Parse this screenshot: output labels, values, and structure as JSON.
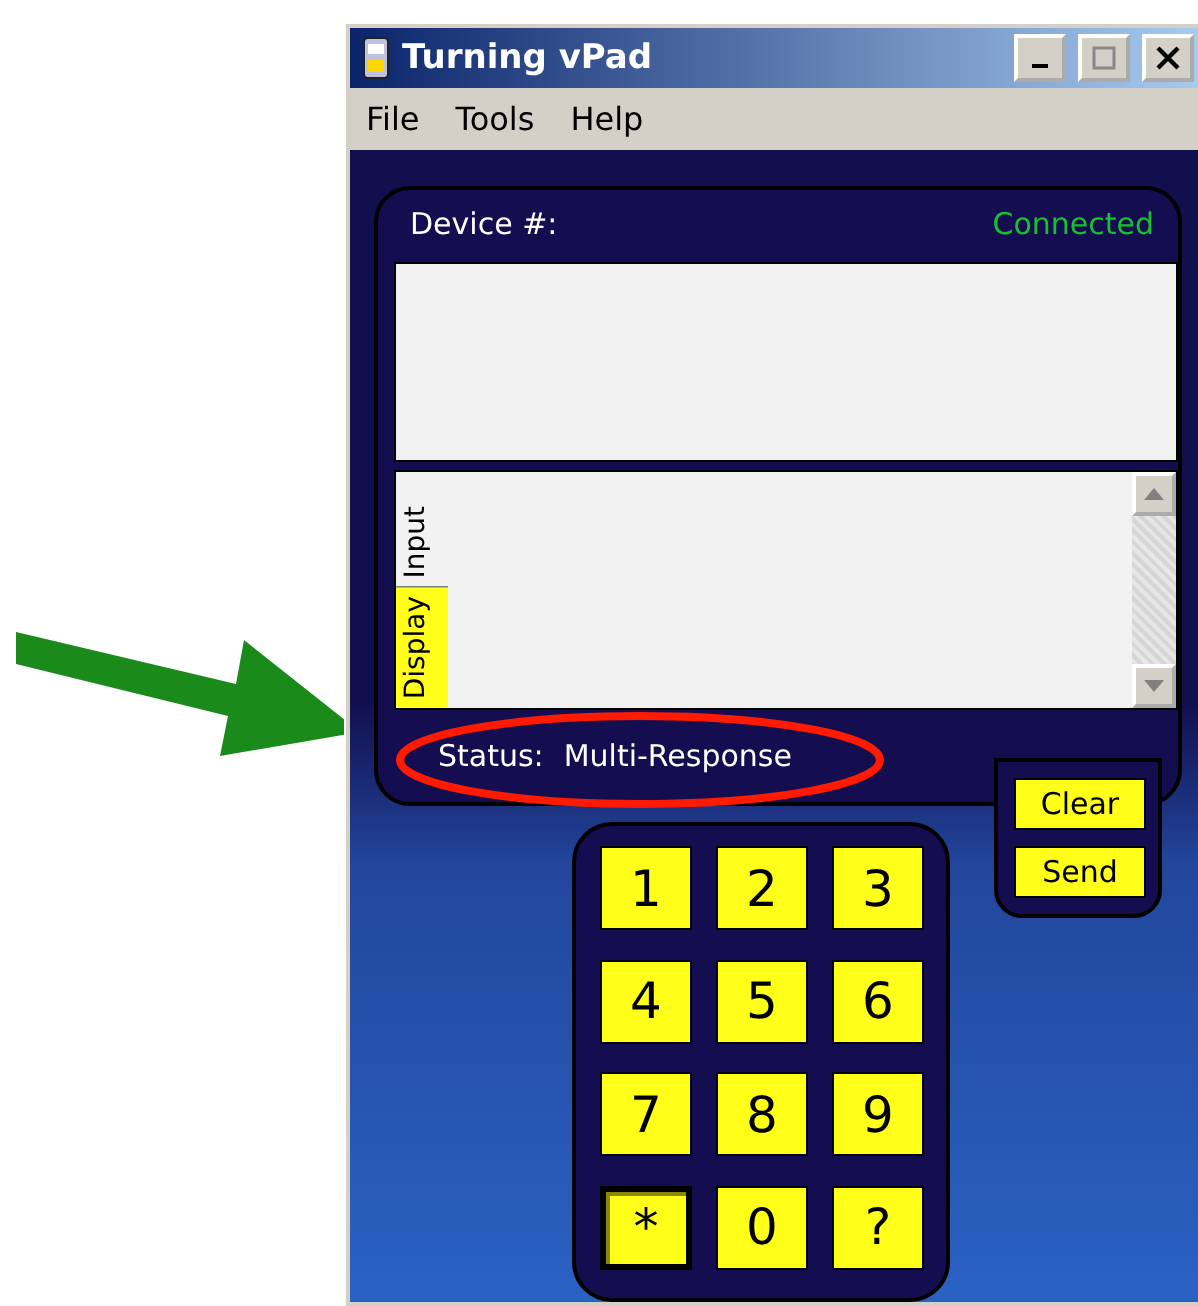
{
  "window": {
    "title": "Turning vPad"
  },
  "menu": [
    "File",
    "Tools",
    "Help"
  ],
  "device": {
    "label": "Device #:",
    "connection": "Connected"
  },
  "tabs": [
    {
      "label": "Input",
      "selected": false
    },
    {
      "label": "Display",
      "selected": true
    }
  ],
  "status": {
    "label": "Status:",
    "value": "Multi-Response"
  },
  "actions": [
    "Clear",
    "Send"
  ],
  "keys": [
    {
      "label": "1",
      "pressed": false
    },
    {
      "label": "2",
      "pressed": false
    },
    {
      "label": "3",
      "pressed": false
    },
    {
      "label": "4",
      "pressed": false
    },
    {
      "label": "5",
      "pressed": false
    },
    {
      "label": "6",
      "pressed": false
    },
    {
      "label": "7",
      "pressed": false
    },
    {
      "label": "8",
      "pressed": false
    },
    {
      "label": "9",
      "pressed": false
    },
    {
      "label": "*",
      "pressed": true
    },
    {
      "label": "0",
      "pressed": false
    },
    {
      "label": "?",
      "pressed": false
    }
  ]
}
